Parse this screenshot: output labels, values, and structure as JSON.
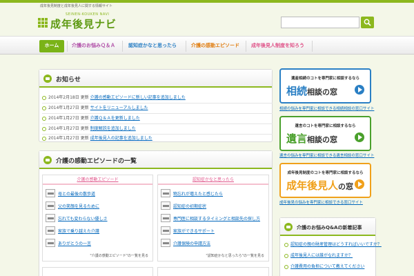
{
  "colors": {
    "accent": "#8cb81e",
    "link": "#0066bb",
    "pink": "#e0558a",
    "blue": "#2a7fc4",
    "green": "#4aa02c",
    "orange": "#f0a01a"
  },
  "header": {
    "tagline": "成年後見制度と成年後見人に関する情報サイト",
    "logo_sub": "SEINEN-KOUKEN NAVI",
    "logo_title": "成年後見ナビ",
    "search_value": "",
    "search_icon": "search-icon"
  },
  "nav": {
    "items": [
      {
        "label": "ホーム",
        "color": "#ffffff"
      },
      {
        "label": "介護のお悩みＱ＆Ａ",
        "color": "#b150a8"
      },
      {
        "label": "認知症かなと思ったら",
        "color": "#2a7fc4"
      },
      {
        "label": "介護の感動エピソード",
        "color": "#e07d10"
      },
      {
        "label": "成年後見人制度を知ろう",
        "color": "#e0558a"
      }
    ]
  },
  "news": {
    "title": "お知らせ",
    "items": [
      {
        "date": "2014年2月18日",
        "cat": "更新",
        "link": "介護の感動エピソードに新しい記事を追加しました"
      },
      {
        "date": "2014年1月27日",
        "cat": "更新",
        "link": "サイトをリニューアルしました"
      },
      {
        "date": "2014年1月27日",
        "cat": "更新",
        "link": "介護Ｑ＆Ａを更新しました"
      },
      {
        "date": "2014年1月27日",
        "cat": "更新",
        "link": "制度解説を追加しました"
      },
      {
        "date": "2014年1月27日",
        "cat": "更新",
        "link": "成年後見人の記事を追加しました"
      }
    ]
  },
  "episodes": {
    "title": "介護の感動エピソードの一覧",
    "columns": [
      {
        "title": "介護の感動エピソード",
        "items": [
          "母との最後の散歩道",
          "父の笑顔を見るために",
          "忘れても変わらない優しさ",
          "家族で乗り越えた介護",
          "ありがとうの一言"
        ],
        "footer": "\"介護の感動エピソード\"の一覧を見る"
      },
      {
        "title": "認知症かなと思ったら",
        "items": [
          "物忘れが増えたと感じたら",
          "認知症の初期症状",
          "専門医に相談するタイミングと相談先の探し方",
          "家族ができるサポート",
          "介護保険の申請方法"
        ],
        "footer": "\"認知症かなと思ったら\"の一覧を見る"
      }
    ]
  },
  "banners": [
    {
      "sub": "遺産相続のコトを専門家に相談するなら",
      "main_big": "相続",
      "main_rest": "相談の窓",
      "link": "相続の悩みを専門家に相談できる相続相談の窓口サイト",
      "color": "#2a7fc4"
    },
    {
      "sub": "遺言のコトを専門家に相談するなら",
      "main_big": "遺言",
      "main_rest": "相談の窓",
      "link": "遺言の悩みを専門家に相談できる遺言相談の窓口サイト",
      "color": "#4aa02c"
    },
    {
      "sub": "成年後見制度のコトを専門家に相談するなら",
      "main_big": "成年後見人",
      "main_rest": "の窓",
      "link": "成年後見の悩みを専門家に相談できる窓口サイト",
      "color": "#f0a01a"
    }
  ],
  "qa": {
    "title": "介護のお悩みQ&Aの新着記事",
    "items": [
      "認知症の親の財産管理はどうすればいいですか？",
      "成年後見人には誰がなれますか？",
      "介護費用の負担について教えてください"
    ]
  }
}
